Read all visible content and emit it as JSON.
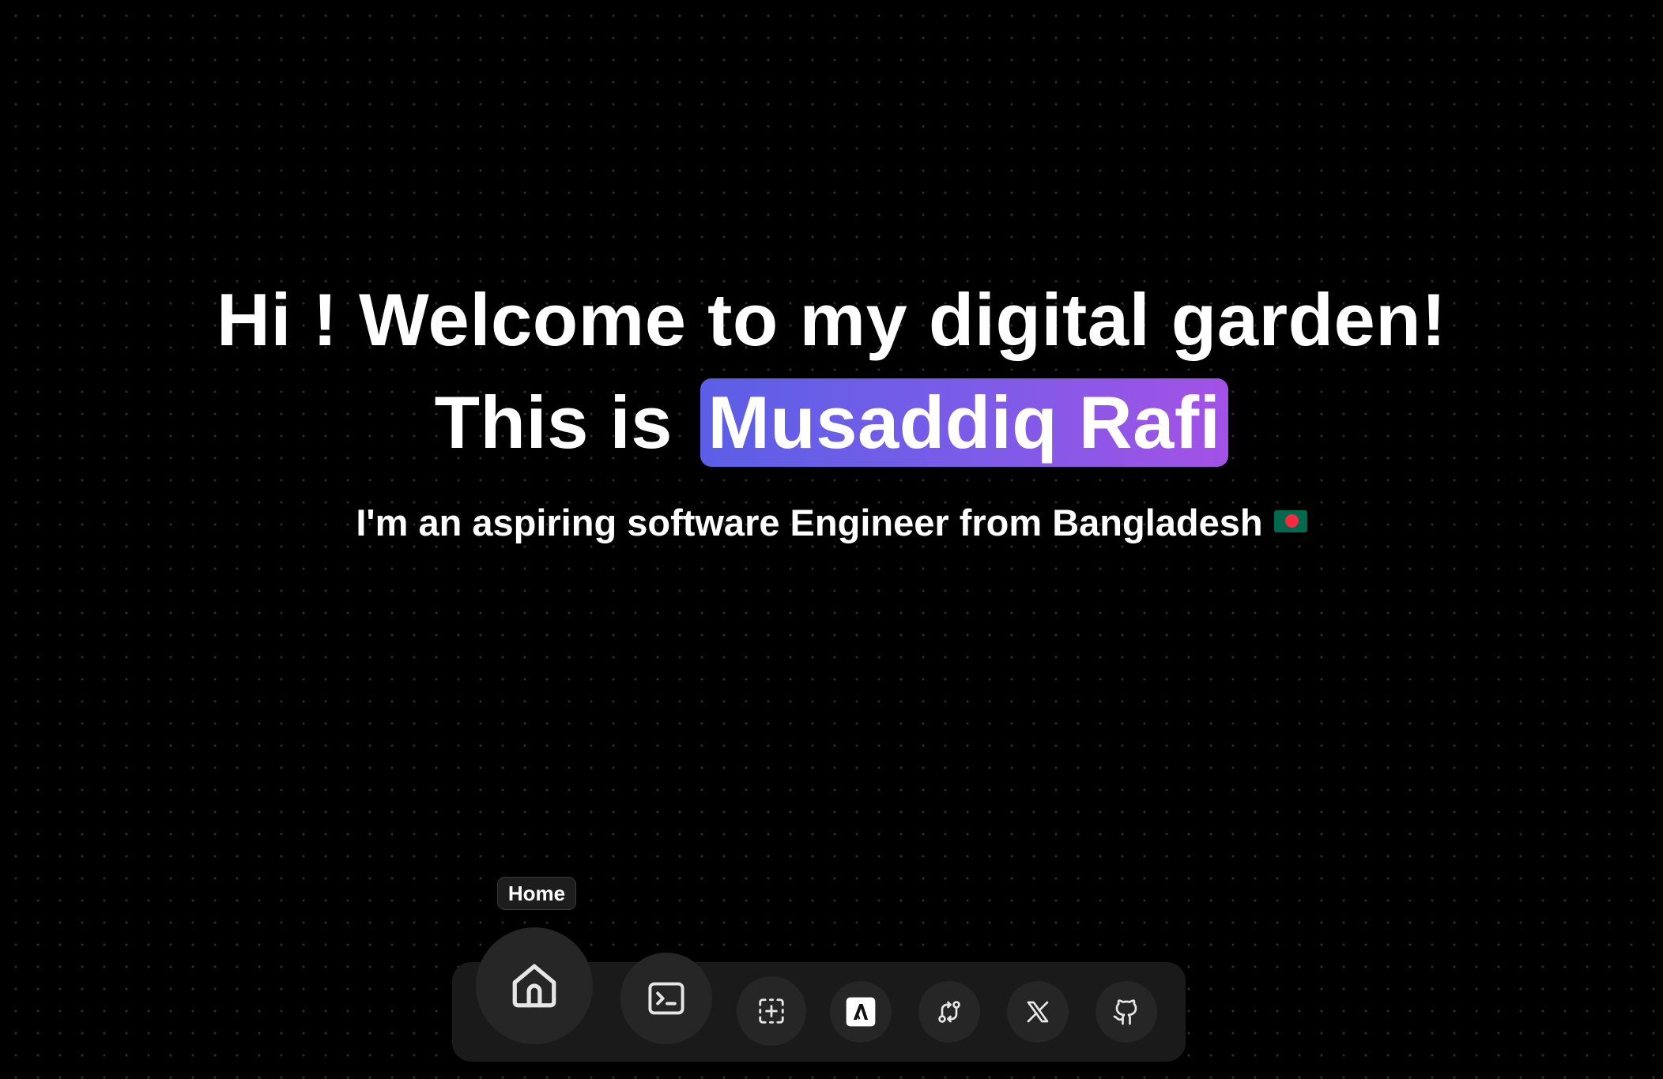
{
  "hero": {
    "line1": "Hi ! Welcome to my digital garden!",
    "line2_prefix": "This is",
    "name": "Musaddiq Rafi",
    "subtitle": "I'm an aspiring software Engineer from Bangladesh"
  },
  "dock": {
    "tooltip": "Home",
    "items": [
      {
        "icon": "home-icon",
        "label": "Home"
      },
      {
        "icon": "terminal-icon"
      },
      {
        "icon": "focus-plus-icon"
      },
      {
        "icon": "hashnode-icon"
      },
      {
        "icon": "git-compare-icon"
      },
      {
        "icon": "x-twitter-icon"
      },
      {
        "icon": "github-icon"
      }
    ]
  },
  "colors": {
    "background": "#000000",
    "highlight_start": "#5b5fe6",
    "highlight_end": "#a352e6",
    "dock_background": "#1a1a1a",
    "dock_item": "#262626"
  }
}
